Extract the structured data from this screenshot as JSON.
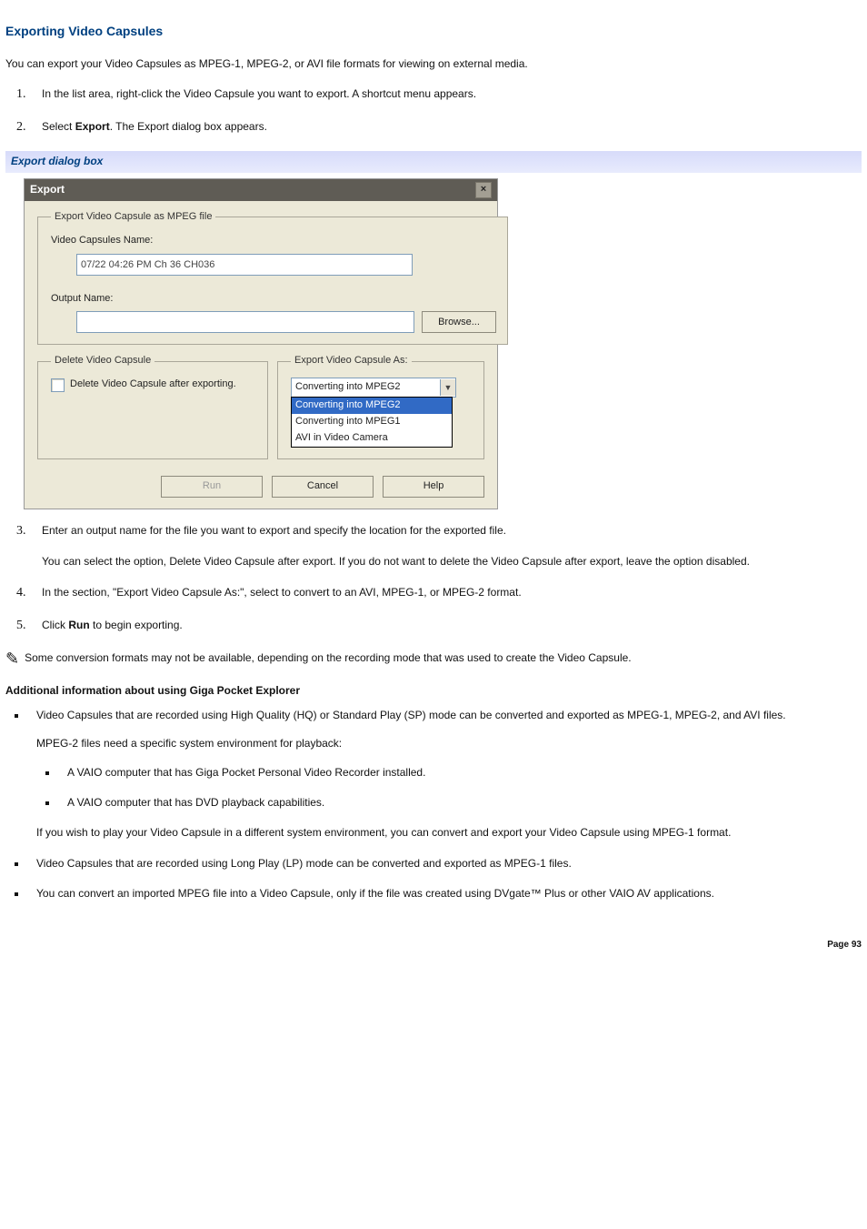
{
  "title": "Exporting Video Capsules",
  "intro": "You can export your Video Capsules as MPEG-1, MPEG-2, or AVI file formats for viewing on external media.",
  "steps12": [
    {
      "pre": "In the list area, right-click the Video Capsule you want to export. A shortcut menu appears."
    },
    {
      "pre": "Select ",
      "bold": "Export",
      "post": ". The Export dialog box appears."
    }
  ],
  "fig_caption": "Export dialog box",
  "dialog": {
    "title": "Export",
    "group1_legend": "Export Video Capsule as MPEG file",
    "name_label": "Video Capsules Name:",
    "name_value": "07/22 04:26 PM Ch 36 CH036",
    "output_label": "Output Name:",
    "browse": "Browse...",
    "group_delete_legend": "Delete Video Capsule",
    "delete_checkbox_label": "Delete Video Capsule after exporting.",
    "group_export_as_legend": "Export Video Capsule As:",
    "select_value": "Converting into MPEG2",
    "options": [
      "Converting into MPEG2",
      "Converting into MPEG1",
      "AVI in Video Camera"
    ],
    "btn_run": "Run",
    "btn_cancel": "Cancel",
    "btn_help": "Help"
  },
  "steps345": [
    {
      "main": "Enter an output name for the file you want to export and specify the location for the exported file.",
      "extra": "You can select the option, Delete Video Capsule after export. If you do not want to delete the Video Capsule after export, leave the option disabled."
    },
    {
      "main": "In the section, \"Export Video Capsule As:\", select to convert to an AVI, MPEG-1, or MPEG-2 format."
    },
    {
      "pre": "Click ",
      "bold": "Run",
      "post": " to begin exporting."
    }
  ],
  "note": " Some conversion formats may not be available, depending on the recording mode that was used to create the Video Capsule.",
  "add_heading": "Additional information about using Giga Pocket Explorer",
  "bullets": {
    "b1a": "Video Capsules that are recorded using High Quality (HQ) or Standard Play (SP) mode can be converted and exported as MPEG-1, MPEG-2, and AVI files.",
    "b1b": "MPEG-2 files need a specific system environment for playback:",
    "b1c1": "A VAIO computer that has Giga Pocket Personal Video Recorder installed.",
    "b1c2": "A VAIO computer that has DVD playback capabilities.",
    "b1d": "If you wish to play your Video Capsule in a different system environment, you can convert and export your Video Capsule using MPEG-1 format.",
    "b2": "Video Capsules that are recorded using Long Play (LP) mode can be converted and exported as MPEG-1 files.",
    "b3": "You can convert an imported MPEG file into a Video Capsule, only if the file was created using DVgate™ Plus or other VAIO AV applications."
  },
  "page_num": "Page 93"
}
